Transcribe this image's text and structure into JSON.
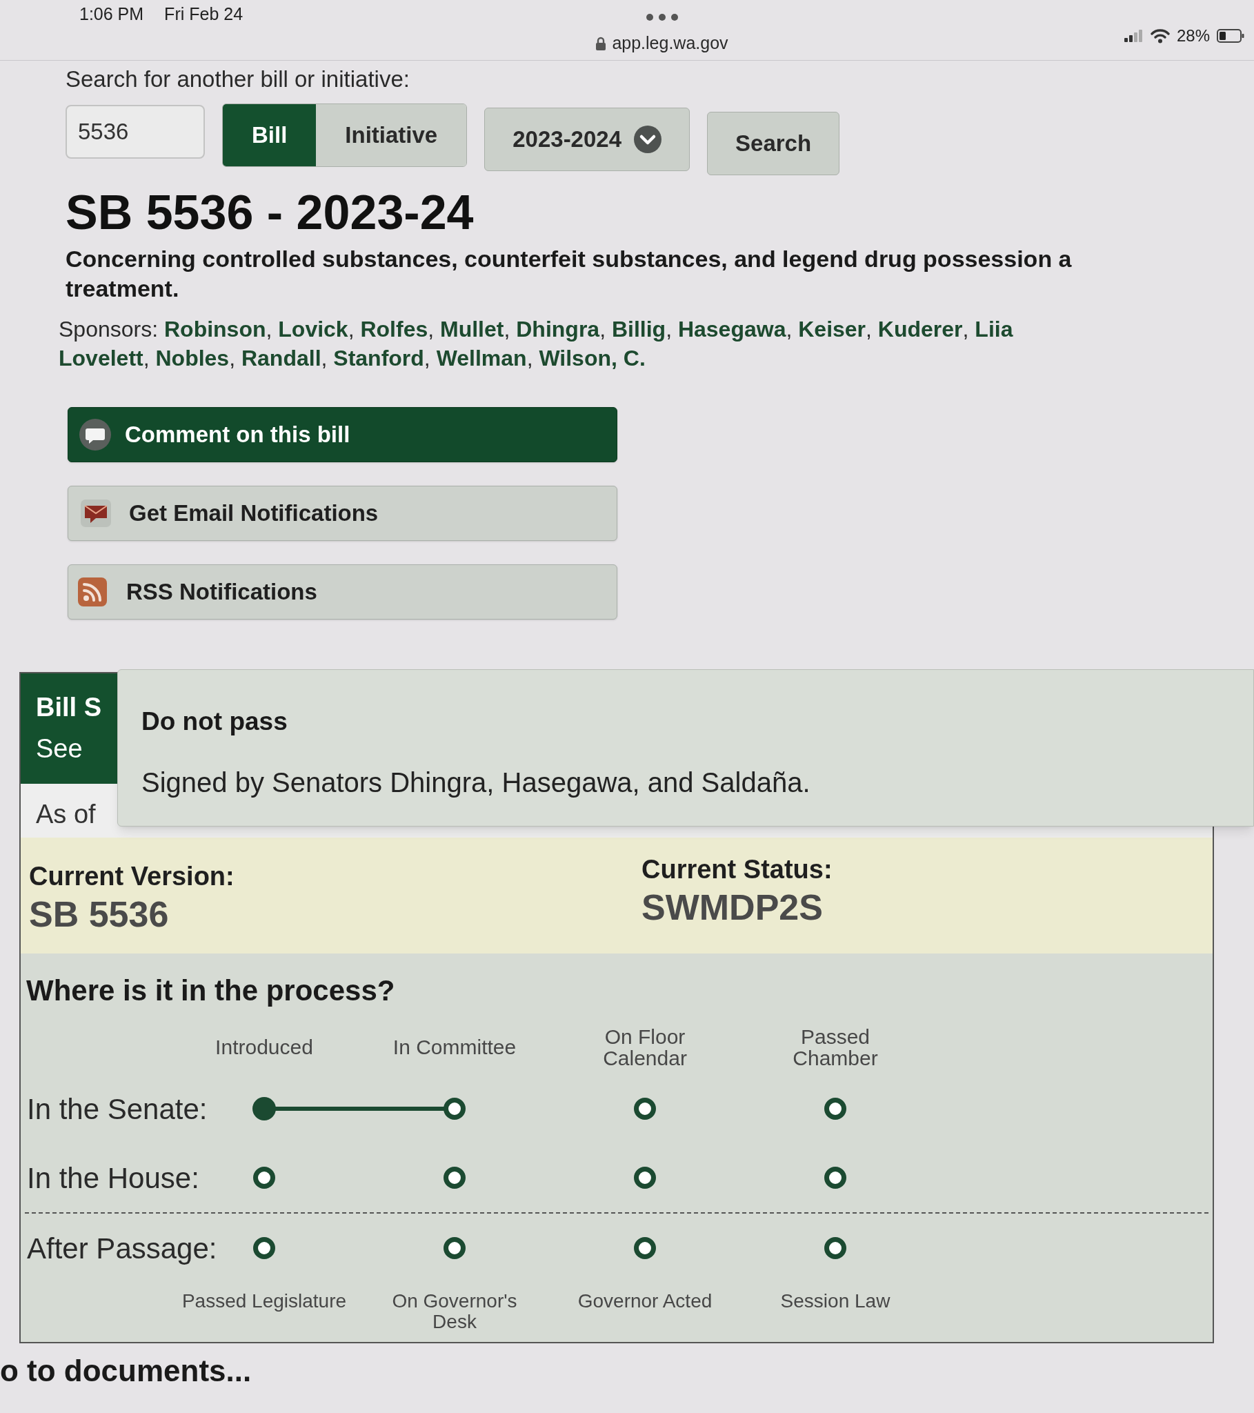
{
  "status_bar": {
    "time": "1:06 PM",
    "date": "Fri Feb 24",
    "url": "app.leg.wa.gov",
    "battery": "28%"
  },
  "search": {
    "label": "Search for another bill or initiative:",
    "value": "5536",
    "types": [
      {
        "label": "Bill",
        "selected": true
      },
      {
        "label": "Initiative",
        "selected": false
      }
    ],
    "session": "2023-2024",
    "button": "Search"
  },
  "bill": {
    "title": "SB 5536 - 2023-24",
    "description_lines": [
      "Concerning controlled substances, counterfeit substances, and legend drug possession a",
      "treatment."
    ],
    "sponsors_lines": [
      "Sponsors: **Robinson**, **Lovick**, **Rolfes**, **Mullet**, **Dhingra**, **Billig**, **Hasegawa**, **Keiser**, **Kuderer**, **Liia**",
      "**Lovelett**, **Nobles**, **Randall**, **Stanford**, **Wellman**, **Wilson, C.**"
    ]
  },
  "actions": {
    "comment": "Comment on this bill",
    "email": "Get Email Notifications",
    "rss": "RSS Notifications"
  },
  "bill_status": {
    "heading": "Bill S",
    "link": "See",
    "as_of": "As of",
    "current_version_label": "Current Version:",
    "current_version": "SB 5536",
    "current_status_label": "Current Status:",
    "current_status": "SWMDP2S"
  },
  "tooltip": {
    "title": "Do not pass",
    "text": "Signed by Senators Dhingra, Hasegawa, and Saldaña."
  },
  "process": {
    "heading": "Where is it in the process?",
    "chamber_step_labels": [
      "Introduced",
      "In Committee",
      "On Floor Calendar",
      "Passed Chamber"
    ],
    "chambers": [
      {
        "label": "In the Senate:",
        "steps": [
          {
            "filled": true,
            "connected": false
          },
          {
            "filled": false,
            "connected": true
          },
          {
            "filled": false,
            "connected": false
          },
          {
            "filled": false,
            "connected": false
          }
        ]
      },
      {
        "label": "In the House:",
        "steps": [
          {
            "filled": false,
            "connected": false
          },
          {
            "filled": false,
            "connected": false
          },
          {
            "filled": false,
            "connected": false
          },
          {
            "filled": false,
            "connected": false
          }
        ]
      }
    ],
    "after_passage": {
      "label": "After Passage:",
      "steps": [
        {
          "filled": false,
          "connected": false
        },
        {
          "filled": false,
          "connected": false
        },
        {
          "filled": false,
          "connected": false
        },
        {
          "filled": false,
          "connected": false
        }
      ],
      "step_labels": [
        "Passed Legislature",
        "On Governor's Desk",
        "Governor Acted",
        "Session Law"
      ]
    }
  },
  "documents_link": "o to documents..."
}
